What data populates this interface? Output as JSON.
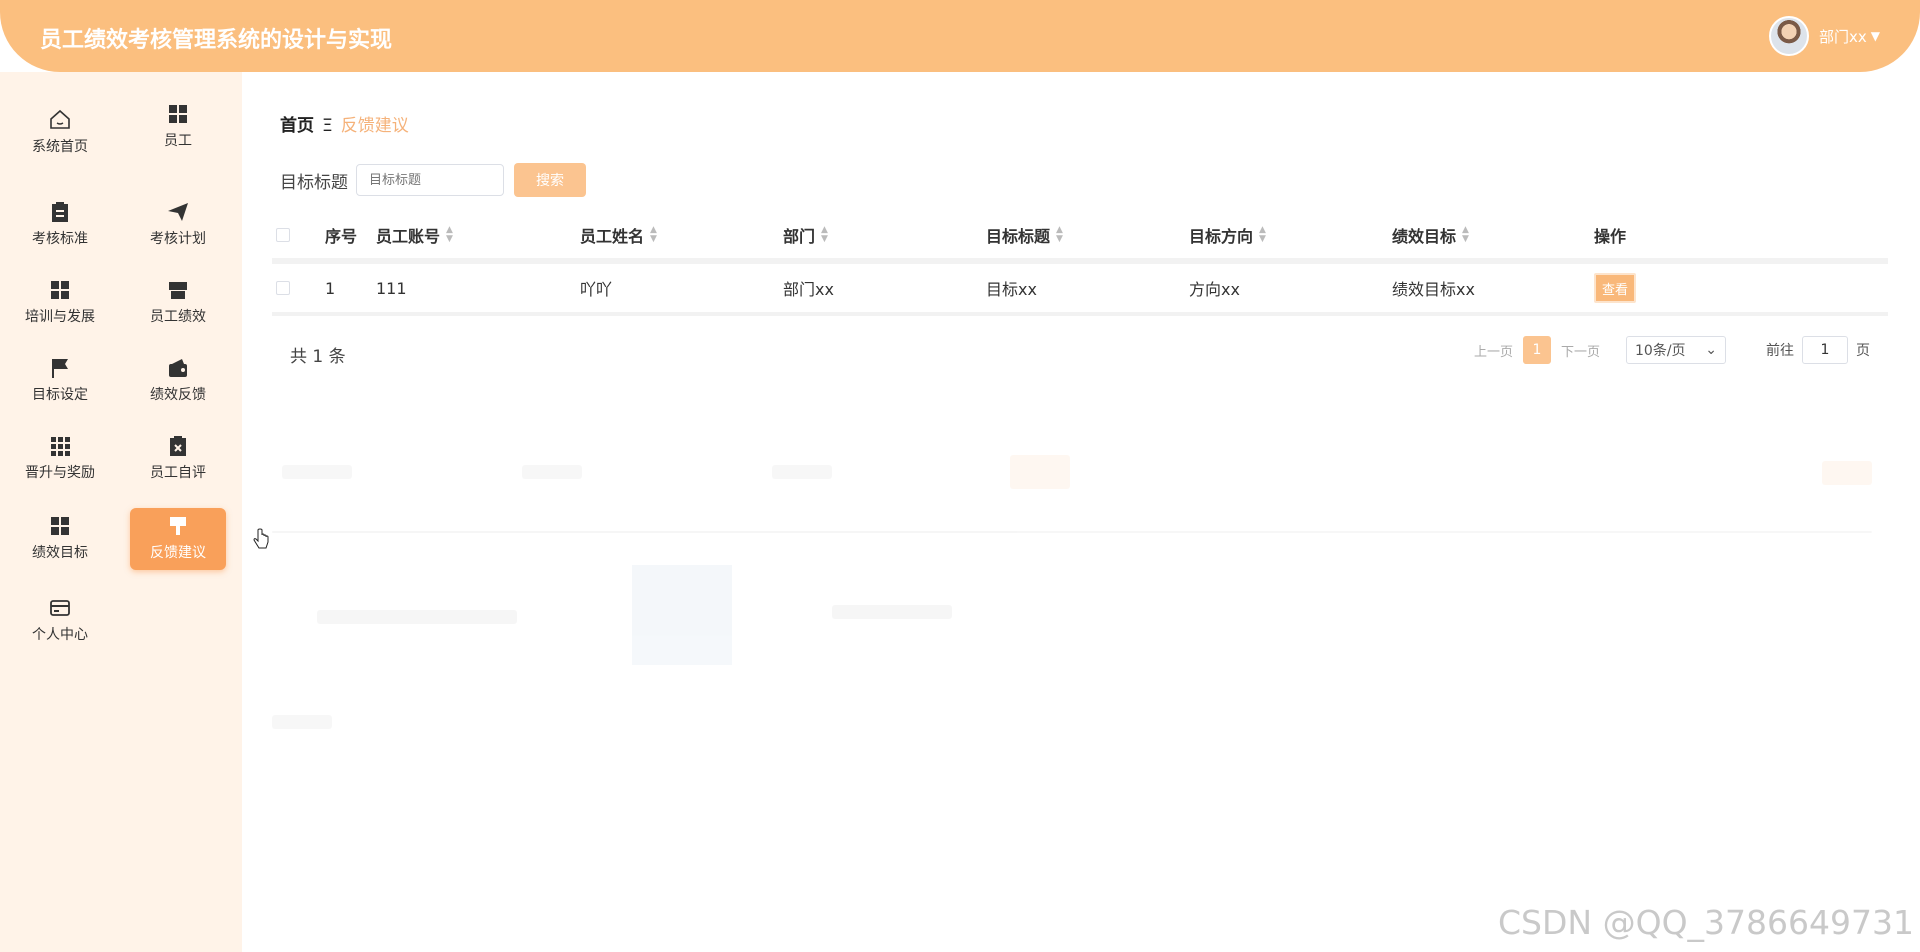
{
  "app": {
    "title": "员工绩效考核管理系统的设计与实现",
    "user": "部门xx"
  },
  "sidebar": {
    "items": [
      {
        "label": "系统首页",
        "icon": "home-icon"
      },
      {
        "label": "员工",
        "icon": "grid-icon"
      },
      {
        "label": "考核标准",
        "icon": "clipboard-icon"
      },
      {
        "label": "考核计划",
        "icon": "send-icon"
      },
      {
        "label": "培训与发展",
        "icon": "grid-icon"
      },
      {
        "label": "员工绩效",
        "icon": "store-icon"
      },
      {
        "label": "目标设定",
        "icon": "flag-icon"
      },
      {
        "label": "绩效反馈",
        "icon": "wallet-icon"
      },
      {
        "label": "晋升与奖励",
        "icon": "apps-icon"
      },
      {
        "label": "员工自评",
        "icon": "clipboard-x-icon"
      },
      {
        "label": "绩效目标",
        "icon": "grid-icon"
      },
      {
        "label": "反馈建议",
        "icon": "brush-icon",
        "active": true
      },
      {
        "label": "个人中心",
        "icon": "card-icon"
      }
    ]
  },
  "breadcrumb": {
    "home": "首页",
    "separator": "Ξ",
    "current": "反馈建议"
  },
  "search": {
    "label": "目标标题",
    "placeholder": "目标标题",
    "button": "搜索"
  },
  "table": {
    "columns": [
      "序号",
      "员工账号",
      "员工姓名",
      "部门",
      "目标标题",
      "目标方向",
      "绩效目标",
      "操作"
    ],
    "rows": [
      {
        "index": "1",
        "account": "111",
        "name": "吖吖",
        "dept": "部门xx",
        "goal_title": "目标xx",
        "direction": "方向xx",
        "perf_goal": "绩效目标xx",
        "action": "查看"
      }
    ]
  },
  "pagination": {
    "total": "共 1 条",
    "prev": "上一页",
    "current_page": "1",
    "next": "下一页",
    "page_size": "10条/页",
    "goto_label": "前往",
    "goto_value": "1",
    "page_suffix": "页"
  },
  "watermark": "CSDN @QQ_3786649731",
  "colors": {
    "accent": "#fbbf7f",
    "active": "#f9a05a",
    "sidebar_bg": "#fff3e8"
  }
}
